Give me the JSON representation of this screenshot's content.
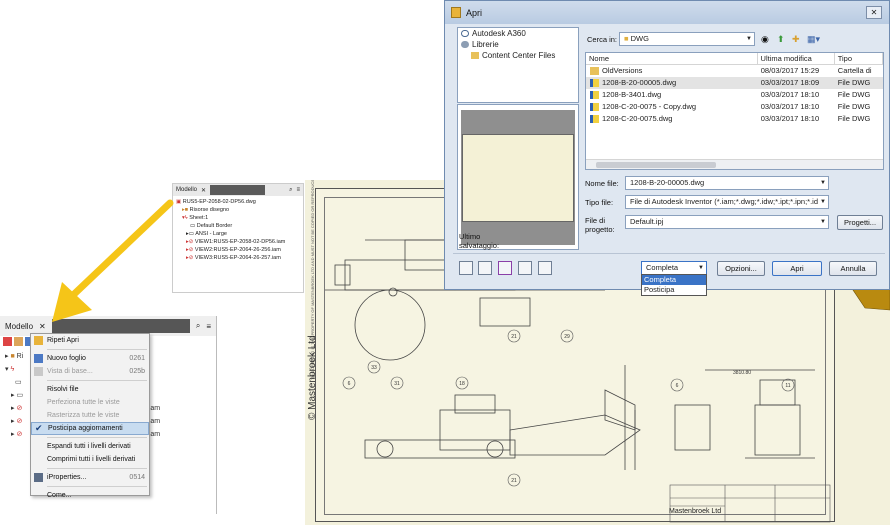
{
  "dialog": {
    "title": "Apri",
    "close_label": "✕",
    "locations": [
      {
        "label": "Autodesk A360",
        "icon": "cloud-icon"
      },
      {
        "label": "Librerie",
        "icon": "library-icon"
      },
      {
        "label": "Content Center Files",
        "icon": "folder-icon"
      }
    ],
    "look_in_label": "Cerca in:",
    "look_in_value": "DWG",
    "columns": [
      "Nome",
      "Ultima modifica",
      "Tipo"
    ],
    "files": [
      {
        "name": "OldVersions",
        "modified": "08/03/2017 15:29",
        "type": "Cartella di",
        "icon": "folder-icon"
      },
      {
        "name": "1208-B-20-00005.dwg",
        "modified": "03/03/2017 18:09",
        "type": "File DWG",
        "icon": "dwg-file-icon",
        "selected": true
      },
      {
        "name": "1208-B-3401.dwg",
        "modified": "03/03/2017 18:10",
        "type": "File DWG",
        "icon": "dwg-file-icon"
      },
      {
        "name": "1208-C-20-0075 - Copy.dwg",
        "modified": "03/03/2017 18:10",
        "type": "File DWG",
        "icon": "dwg-file-icon"
      },
      {
        "name": "1208-C-20-0075.dwg",
        "modified": "03/03/2017 18:10",
        "type": "File DWG",
        "icon": "dwg-file-icon"
      }
    ],
    "filename_label": "Nome file:",
    "filename_value": "1208-B-20-00005.dwg",
    "filetype_label": "Tipo file:",
    "filetype_value": "File di Autodesk Inventor (*.iam;*.dwg;*.idw;*.ipt;*.ipn;*.ide)",
    "project_label_1": "File di",
    "project_label_2": "progetto:",
    "project_value": "Default.ipj",
    "projects_button": "Progetti...",
    "last_saved_label_1": "Ultimo",
    "last_saved_label_2": "salvataggio:",
    "mode_value": "Completa",
    "mode_options": [
      "Completa",
      "Posticipa"
    ],
    "options_button": "Opzioni...",
    "open_button": "Apri",
    "cancel_button": "Annulla"
  },
  "small_browser": {
    "tab": "Modello",
    "tree": [
      "RUS5-EP-2058-02-DP56.dwg",
      "Risorse disegno",
      "Sheet:1",
      "Default Border",
      "ANSI - Large",
      "VIEW1:RUS5-EP-2058-02-DP56.iam",
      "VIEW2:RUS5-EP-2064-26-256.iam",
      "VIEW3:RUS5-EP-2064-26-257.iam"
    ]
  },
  "browser": {
    "tab": "Modello",
    "close": "✕",
    "tree_fragments": [
      "Ri",
      "am",
      "am",
      "am"
    ]
  },
  "context_menu": {
    "items": [
      {
        "label": "Ripeti Apri",
        "shortcut": "",
        "disabled": false
      },
      {
        "label": "Nuovo foglio",
        "shortcut": "0261",
        "disabled": false
      },
      {
        "label": "Vista di base...",
        "shortcut": "025b",
        "disabled": true
      },
      {
        "label": "Risolvi file",
        "shortcut": "",
        "disabled": false
      },
      {
        "label": "Perfeziona tutte le viste",
        "shortcut": "",
        "disabled": true
      },
      {
        "label": "Rasterizza tutte le viste",
        "shortcut": "",
        "disabled": true
      },
      {
        "label": "Posticipa aggiornamenti",
        "shortcut": "",
        "disabled": false,
        "checked": true
      },
      {
        "label": "Espandi tutti i livelli derivati",
        "shortcut": "",
        "disabled": false
      },
      {
        "label": "Comprimi tutti i livelli derivati",
        "shortcut": "",
        "disabled": false
      },
      {
        "label": "iProperties...",
        "shortcut": "0514",
        "disabled": false
      },
      {
        "label": "Come...",
        "shortcut": "",
        "disabled": false
      }
    ]
  },
  "drawing": {
    "company_vertical": "© Mastenbroek Ltd",
    "title_block_company": "Mastenbroek Ltd",
    "dimension_1": "3810.80",
    "callouts": [
      "21",
      "29",
      "33",
      "6",
      "31",
      "18",
      "6",
      "21",
      "11"
    ]
  },
  "colors": {
    "arrow": "#f5c518",
    "highlight": "#c8dcf0",
    "paper": "#f3f1dc"
  }
}
